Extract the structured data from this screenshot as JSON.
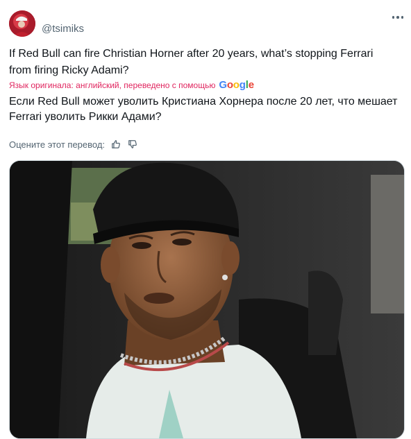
{
  "post": {
    "handle": "@tsimiks",
    "text": "If Red Bull can fire Christian Horner after 20 years, what’s stopping Ferrari from firing Ricky Adami?",
    "translation_note": "Язык оригинала: английский, переведено с помощью",
    "translation_provider": "Google",
    "translated_text": "Если Red Bull может уволить Кристиана Хорнера после 20 лет, что мешает Ferrari уволить Рикки Адами?",
    "rate_label": "Оцените этот перевод:",
    "more_icon": "more-horizontal-icon",
    "thumbs_up_icon": "thumbs-up-icon",
    "thumbs_down_icon": "thumbs-down-icon"
  },
  "colors": {
    "text": "#0f1419",
    "secondary": "#536471",
    "translation_note": "#e0245e",
    "border": "#cfd9de"
  }
}
